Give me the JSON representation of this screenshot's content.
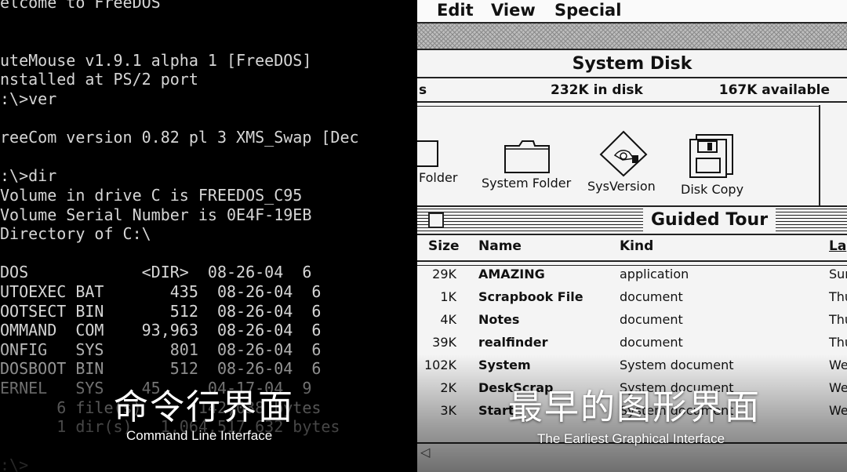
{
  "dos": {
    "lines": [
      "elcome to FreeDOS",
      "",
      "",
      "uteMouse v1.9.1 alpha 1 [FreeDOS]",
      "nstalled at PS/2 port",
      ":\\>ver",
      "",
      "reeCom version 0.82 pl 3 XMS_Swap [Dec",
      "",
      ":\\>dir",
      "Volume in drive C is FREEDOS_C95",
      "Volume Serial Number is 0E4F-19EB",
      "Directory of C:\\",
      "",
      "DOS            <DIR>  08-26-04  6",
      "UTOEXEC BAT       435  08-26-04  6",
      "OOTSECT BIN       512  08-26-04  6",
      "OMMAND  COM    93,963  08-26-04  6",
      "ONFIG   SYS       801  08-26-04  6",
      "DOSBOOT BIN       512  08-26-04  6",
      "ERNEL   SYS    45,    04-17-04  9",
      "      6 file(s)      142,038 bytes",
      "      1 dir(s)   1,064,517,632 bytes",
      "",
      ":\\>"
    ]
  },
  "mac": {
    "menu": [
      "Edit",
      "View",
      "Special"
    ],
    "system_disk": {
      "title": "System Disk",
      "items_suffix": "s",
      "in_disk": "232K in disk",
      "available": "167K available",
      "icons": [
        {
          "label": "Folder",
          "icon": "folder-icon"
        },
        {
          "label": "System Folder",
          "icon": "folder-icon"
        },
        {
          "label": "SysVersion",
          "icon": "document-icon"
        },
        {
          "label": "Disk Copy",
          "icon": "floppy-icon"
        }
      ]
    },
    "guided_tour": {
      "title": "Guided Tour",
      "columns": {
        "size": "Size",
        "name": "Name",
        "kind": "Kind",
        "last": "La"
      },
      "rows": [
        {
          "size": "29K",
          "name": "AMAZING",
          "kind": "application",
          "last": "Sun"
        },
        {
          "size": "1K",
          "name": "Scrapbook File",
          "kind": "document",
          "last": "Thu"
        },
        {
          "size": "4K",
          "name": "Notes",
          "kind": "document",
          "last": "Thu"
        },
        {
          "size": "39K",
          "name": "realfinder",
          "kind": "document",
          "last": "Thu"
        },
        {
          "size": "102K",
          "name": "System",
          "kind": "System document",
          "last": "Wed"
        },
        {
          "size": "2K",
          "name": "DeskScrap",
          "kind": "System document",
          "last": "Wed"
        },
        {
          "size": "3K",
          "name": "Start",
          "kind": "System document",
          "last": "Wed"
        }
      ]
    }
  },
  "captions": {
    "left_zh": "命令行界面",
    "left_en": "Command Line Interface",
    "right_zh": "最早的图形界面",
    "right_en": "The Earliest Graphical Interface"
  }
}
